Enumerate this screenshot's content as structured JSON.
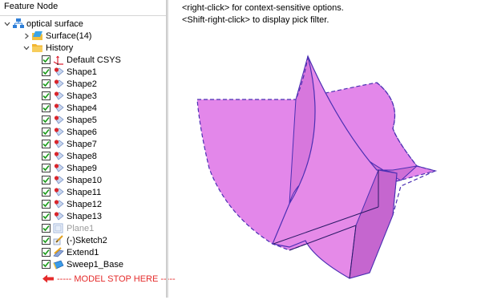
{
  "panel": {
    "header": "Feature Node"
  },
  "tree": {
    "root": {
      "label": "optical surface"
    },
    "surface": {
      "label": "Surface(14)"
    },
    "history": {
      "label": "History"
    },
    "items": [
      {
        "label": "Default CSYS",
        "icon": "csys-icon"
      },
      {
        "label": "Shape1",
        "icon": "shape-icon"
      },
      {
        "label": "Shape2",
        "icon": "shape-icon"
      },
      {
        "label": "Shape3",
        "icon": "shape-icon"
      },
      {
        "label": "Shape4",
        "icon": "shape-icon"
      },
      {
        "label": "Shape5",
        "icon": "shape-icon"
      },
      {
        "label": "Shape6",
        "icon": "shape-icon"
      },
      {
        "label": "Shape7",
        "icon": "shape-icon"
      },
      {
        "label": "Shape8",
        "icon": "shape-icon"
      },
      {
        "label": "Shape9",
        "icon": "shape-icon"
      },
      {
        "label": "Shape10",
        "icon": "shape-icon"
      },
      {
        "label": "Shape11",
        "icon": "shape-icon"
      },
      {
        "label": "Shape12",
        "icon": "shape-icon"
      },
      {
        "label": "Shape13",
        "icon": "shape-icon"
      },
      {
        "label": "Plane1",
        "icon": "plane-icon",
        "dimmed": true
      },
      {
        "label": "(-)Sketch2",
        "icon": "sketch-icon"
      },
      {
        "label": "Extend1",
        "icon": "extend-icon"
      },
      {
        "label": "Sweep1_Base",
        "icon": "sweep-icon"
      }
    ],
    "model_stop": "----- MODEL STOP HERE -----"
  },
  "hints": {
    "line1": "<right-click> for context-sensitive options.",
    "line2": "<Shift-right-click> to display pick filter."
  },
  "colors": {
    "surface_fill": "#e58ae8",
    "surface_edge": "#4b2fb3",
    "stop_red": "#e52b2b",
    "check_green": "#1a9a1a"
  }
}
